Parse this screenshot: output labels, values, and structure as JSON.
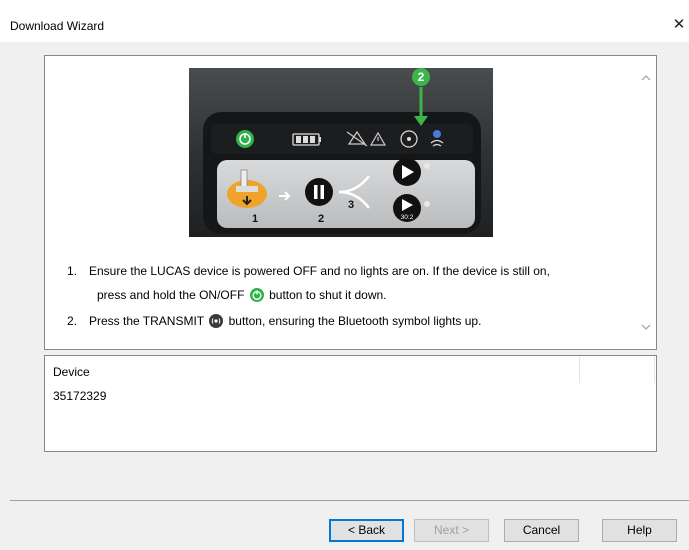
{
  "window": {
    "title": "Download Wizard",
    "close_label": "✕"
  },
  "instructions": {
    "step1_num": "1.",
    "step1_line1": "Ensure the LUCAS device is powered OFF and no lights are on. If the device is still on,",
    "step1_line2_pre": "press and hold the ON/OFF",
    "step1_line2_post": "button to shut it down.",
    "step2_num": "2.",
    "step2_pre": "Press the TRANSMIT",
    "step2_post": "button, ensuring the Bluetooth symbol lights up."
  },
  "device_image": {
    "callout_number": "2",
    "step_labels": [
      "1",
      "2",
      "3"
    ],
    "button_label_302": "30:2"
  },
  "device_list": {
    "column_header": "Device",
    "rows": [
      "35172329"
    ]
  },
  "buttons": {
    "back": "< Back",
    "next": "Next >",
    "cancel": "Cancel",
    "help": "Help"
  },
  "colors": {
    "accent_focus": "#0078d7",
    "power_green": "#2eb34a",
    "callout_green": "#3bb44a",
    "indicator_orange": "#f0a32b"
  },
  "icons": {
    "close": "close-icon",
    "scroll_up": "chevron-up-icon",
    "scroll_down": "chevron-down-icon",
    "power": "power-icon",
    "transmit": "transmit-icon"
  }
}
